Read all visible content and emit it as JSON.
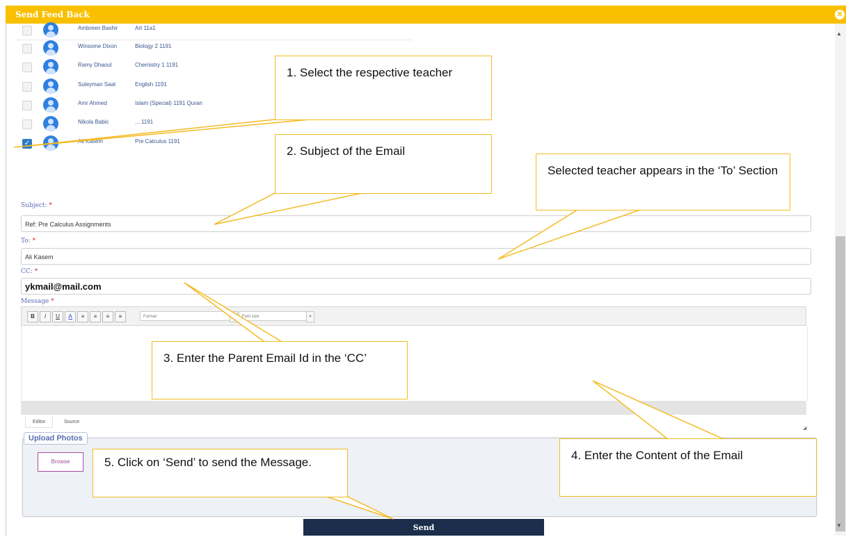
{
  "window": {
    "title": "Send Feed Back",
    "close_symbol": "✕"
  },
  "teachers": [
    {
      "name": "Ambreen Bashir",
      "subject": "Art 11a1",
      "checked": false
    },
    {
      "name": "Winsome Dixon",
      "subject": "Biology 2 1191",
      "checked": false
    },
    {
      "name": "Ramy Dhaoul",
      "subject": "Chemistry 1 1191",
      "checked": false
    },
    {
      "name": "Suleyman Saat",
      "subject": "English 1191",
      "checked": false
    },
    {
      "name": "Amr Ahmed",
      "subject": "Islam (Special) 1191 Quran",
      "checked": false
    },
    {
      "name": "Nikola Babic",
      "subject": "... 1191",
      "checked": false
    },
    {
      "name": "Ali Kasem",
      "subject": "Pre Calculus 1191",
      "checked": true
    }
  ],
  "form": {
    "subject_label": "Subject:",
    "subject_value": "Ref: Pre Calculus Assignments",
    "to_label": "To:",
    "to_value": "Ali Kasem",
    "cc_label": "CC:",
    "cc_value": "ykmail@mail.com",
    "message_label": "Message",
    "required_mark": "*"
  },
  "toolbar": {
    "bold": "B",
    "italic": "I",
    "underline": "U",
    "font_color": "A",
    "format_placeholder": "Format",
    "font_size_placeholder": "Font size"
  },
  "editor_tabs": {
    "editor": "Editor",
    "source": "Source"
  },
  "upload": {
    "legend": "Upload Photos",
    "browse": "Browse"
  },
  "send_button": "Send",
  "callouts": {
    "c1": "1. Select the respective teacher",
    "c2": "2. Subject of the Email",
    "c_to": "Selected teacher appears in the ‘To’ Section",
    "c3": "3. Enter the Parent Email Id in the ‘CC’",
    "c4": "4. Enter the Content of the Email",
    "c5": "5. Click on ‘Send’ to send the Message."
  },
  "colors": {
    "title_bar": "#f9c000",
    "callout_border": "#f3bb21",
    "send_button": "#1b2f4c",
    "browse_border": "#a44ca0"
  }
}
